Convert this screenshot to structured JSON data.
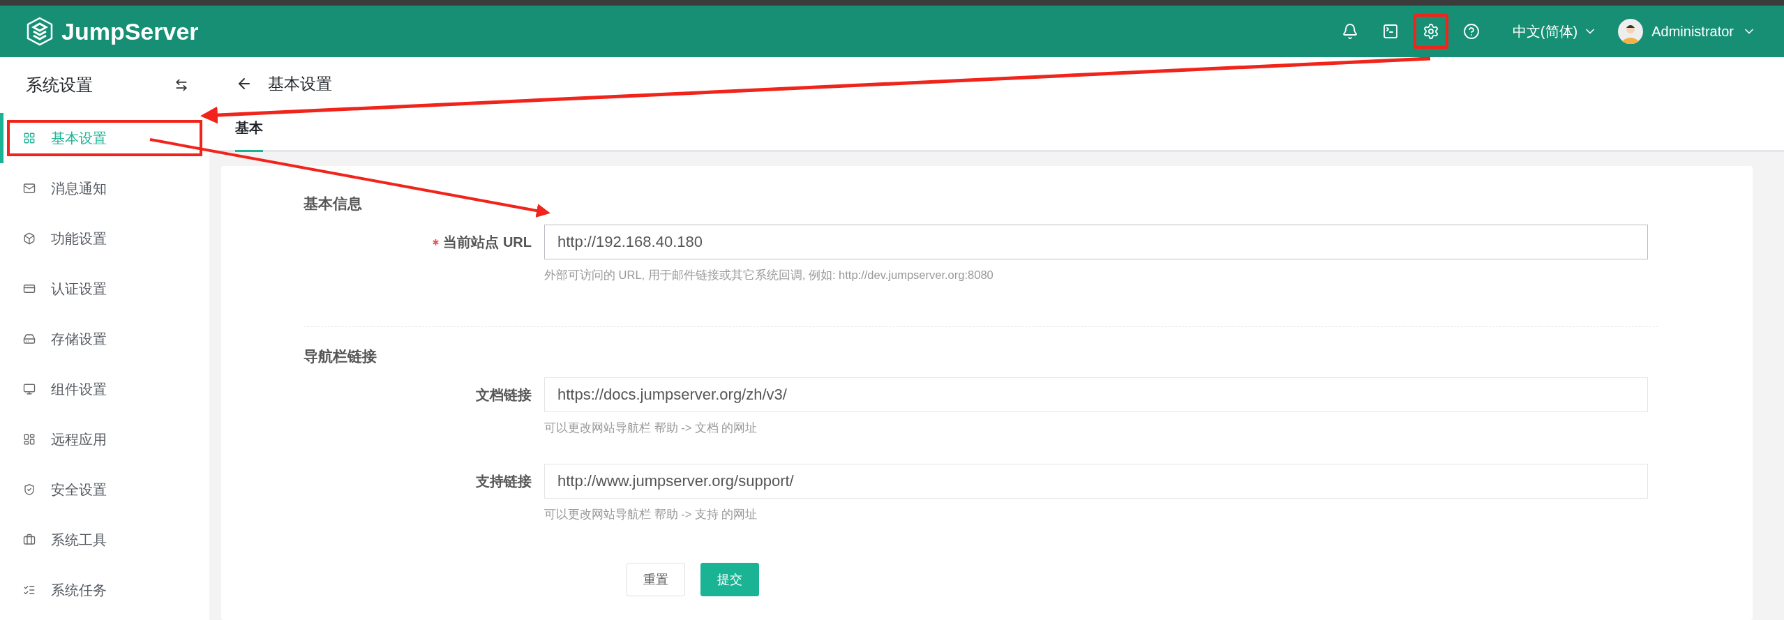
{
  "header": {
    "logo": "JumpServer",
    "toolbar": [
      {
        "kind": "bell",
        "highlighted": false
      },
      {
        "kind": "terminal",
        "highlighted": false
      },
      {
        "kind": "settings",
        "highlighted": true
      },
      {
        "kind": "help",
        "highlighted": false
      }
    ],
    "language": "中文(简体)",
    "user": "Administrator"
  },
  "sidebar": {
    "title": "系统设置",
    "items": [
      {
        "kind": "grid",
        "label": "基本设置",
        "selected": true,
        "highlighted": true
      },
      {
        "kind": "mail",
        "label": "消息通知",
        "selected": false,
        "highlighted": false
      },
      {
        "kind": "cube",
        "label": "功能设置",
        "selected": false,
        "highlighted": false
      },
      {
        "kind": "card",
        "label": "认证设置",
        "selected": false,
        "highlighted": false
      },
      {
        "kind": "storage",
        "label": "存储设置",
        "selected": false,
        "highlighted": false
      },
      {
        "kind": "monitor",
        "label": "组件设置",
        "selected": false,
        "highlighted": false
      },
      {
        "kind": "apps",
        "label": "远程应用",
        "selected": false,
        "highlighted": false
      },
      {
        "kind": "shield",
        "label": "安全设置",
        "selected": false,
        "highlighted": false
      },
      {
        "kind": "toolbox",
        "label": "系统工具",
        "selected": false,
        "highlighted": false
      },
      {
        "kind": "tasks",
        "label": "系统任务",
        "selected": false,
        "highlighted": false
      }
    ]
  },
  "page": {
    "title": "基本设置",
    "tabs": [
      {
        "label": "基本",
        "selected": true
      }
    ]
  },
  "form": {
    "sections": [
      {
        "title": "基本信息",
        "fields": [
          {
            "label": "当前站点 URL",
            "required": true,
            "value": "http://192.168.40.180",
            "hint": "外部可访问的 URL, 用于邮件链接或其它系统回调, 例如: http://dev.jumpserver.org:8080"
          }
        ]
      },
      {
        "title": "导航栏链接",
        "fields": [
          {
            "label": "文档链接",
            "required": false,
            "value": "https://docs.jumpserver.org/zh/v3/",
            "hint": "可以更改网站导航栏 帮助 -> 文档 的网址"
          },
          {
            "label": "支持链接",
            "required": false,
            "value": "http://www.jumpserver.org/support/",
            "hint": "可以更改网站导航栏 帮助 -> 支持 的网址"
          }
        ]
      }
    ],
    "buttons": [
      {
        "kind": "reset",
        "label": "重置"
      },
      {
        "kind": "submit",
        "label": "提交"
      }
    ]
  }
}
